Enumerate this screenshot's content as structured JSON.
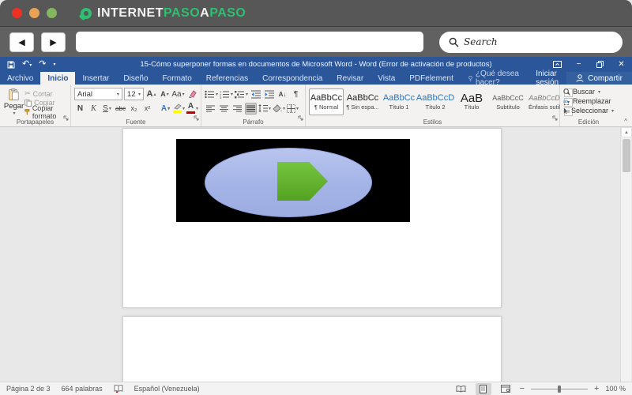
{
  "colors": {
    "word_accent_blue": "#2b579a",
    "brand_green": "#2fbf71",
    "shape_canvas_black": "#000000",
    "shape_ellipse_blue": "#a9b8e8",
    "shape_arrow_green": "#62b52e",
    "highlight_yellow": "#ffff00",
    "font_color_red": "#c00000"
  },
  "icons": {
    "back": "◀",
    "forward": "▶",
    "undo": "↶",
    "redo": "↷",
    "dropdown": "▾",
    "up": "▴",
    "minimize": "−",
    "close": "✕",
    "cut": "✂",
    "pilcrow": "¶",
    "sort": "A↓",
    "collapse": "^",
    "scroll_up": "▲",
    "gallery_more": "≡"
  },
  "browser": {
    "brand": {
      "part1": "INTERNET",
      "part2": "PASO",
      "part3": "A",
      "part4": "PASO"
    },
    "address_value": "",
    "search_placeholder": "Search"
  },
  "titlebar": {
    "title": "15-Cómo superponer formas en documentos de Microsoft Word - Word (Error de activación de productos)"
  },
  "tabs": [
    {
      "label": "Archivo"
    },
    {
      "label": "Inicio"
    },
    {
      "label": "Insertar"
    },
    {
      "label": "Diseño"
    },
    {
      "label": "Formato"
    },
    {
      "label": "Referencias"
    },
    {
      "label": "Correspondencia"
    },
    {
      "label": "Revisar"
    },
    {
      "label": "Vista"
    },
    {
      "label": "PDFelement"
    }
  ],
  "tellme": "¿Qué desea hacer?",
  "account": {
    "sign_in": "Iniciar sesión",
    "share": "Compartir"
  },
  "ribbon": {
    "clipboard": {
      "paste": "Pegar",
      "cut": "Cortar",
      "copy": "Copiar",
      "format_painter": "Copiar formato",
      "label": "Portapapeles"
    },
    "font": {
      "family": "Arial",
      "size": "12",
      "grow": "A",
      "shrink": "A",
      "change_case": "Aa",
      "bold": "N",
      "italic": "K",
      "underline": "S",
      "strike": "abc",
      "subscript": "x₂",
      "superscript": "x²",
      "effects": "A",
      "highlight": "ab",
      "color": "A",
      "label": "Fuente"
    },
    "paragraph": {
      "label": "Párrafo"
    },
    "styles": {
      "label": "Estilos",
      "items": [
        {
          "sample": "AaBbCc",
          "name": "¶ Normal"
        },
        {
          "sample": "AaBbCc",
          "name": "¶ Sin espa..."
        },
        {
          "sample": "AaBbCc",
          "name": "Título 1"
        },
        {
          "sample": "AaBbCcD",
          "name": "Título 2"
        },
        {
          "sample": "AaB",
          "name": "Título"
        },
        {
          "sample": "AaBbCcC",
          "name": "Subtítulo"
        },
        {
          "sample": "AaBbCcD",
          "name": "Énfasis sutil"
        }
      ]
    },
    "editing": {
      "find": "Buscar",
      "replace": "Reemplazar",
      "select": "Seleccionar",
      "label": "Edición"
    }
  },
  "statusbar": {
    "page": "Página 2 de 3",
    "words": "664 palabras",
    "language": "Español (Venezuela)",
    "zoom_out": "−",
    "zoom_in": "+",
    "zoom_level": "100 %"
  }
}
